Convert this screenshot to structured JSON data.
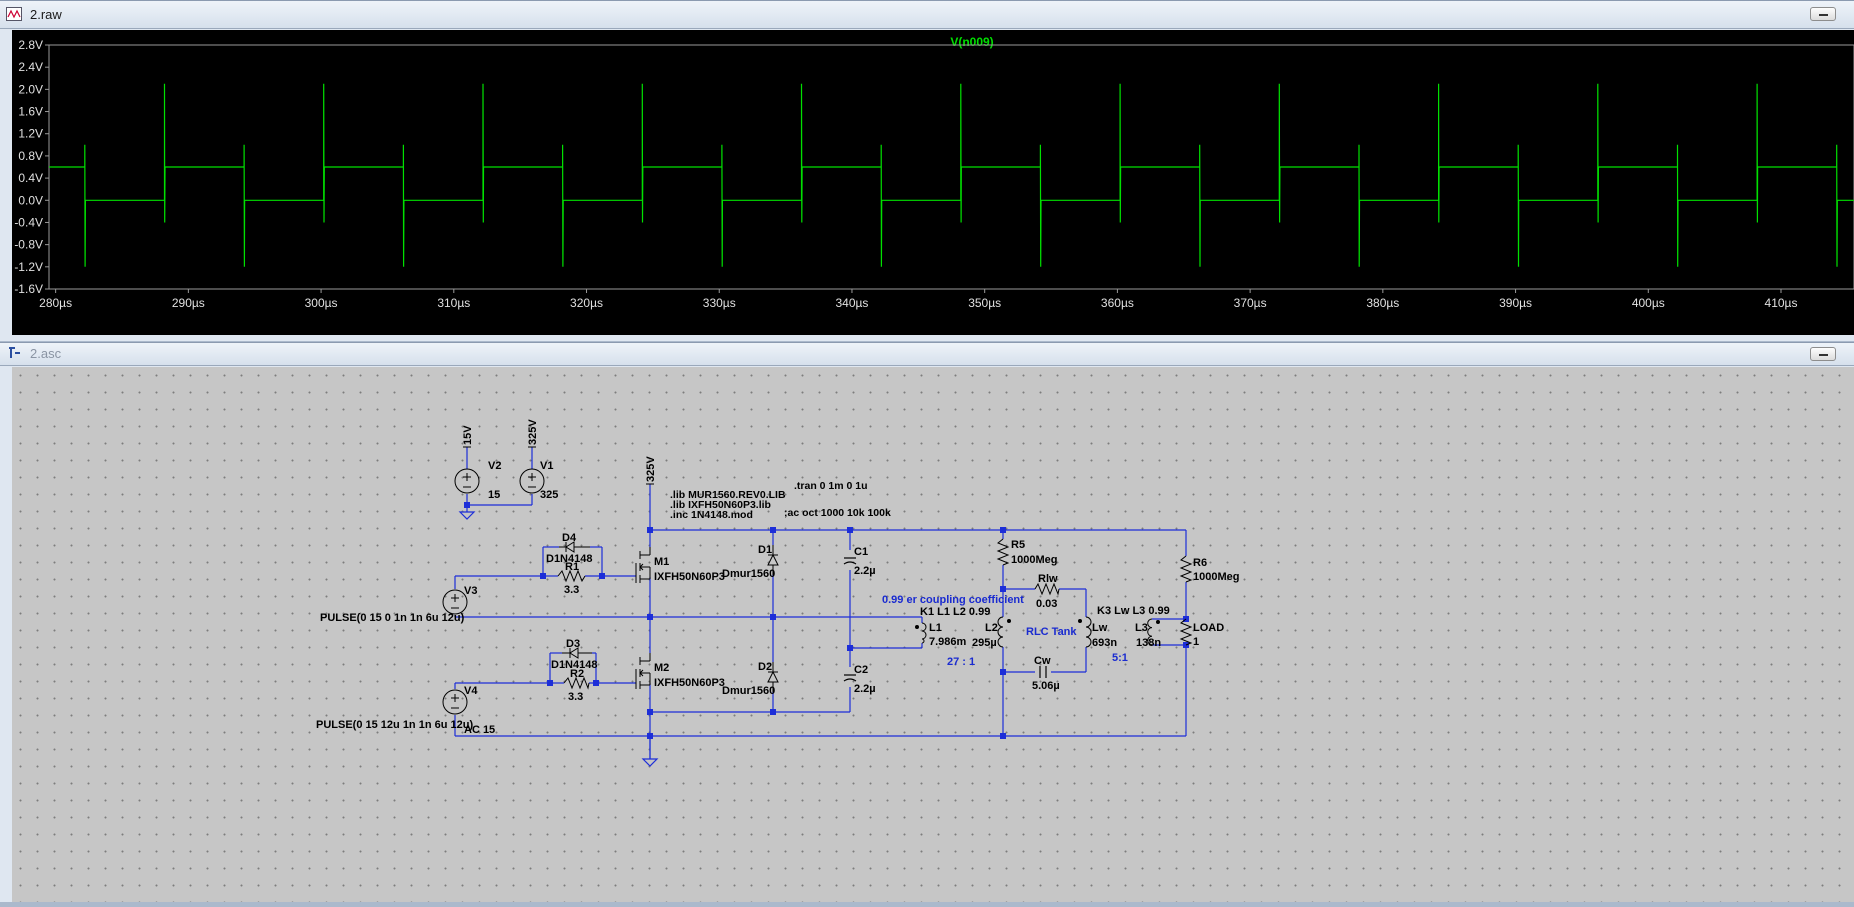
{
  "waveform_window": {
    "title": "2.raw",
    "trace_label": "V(n009)",
    "trace_color": "#00e000",
    "y_ticks": [
      "2.8V",
      "2.4V",
      "2.0V",
      "1.6V",
      "1.2V",
      "0.8V",
      "0.4V",
      "0.0V",
      "-0.4V",
      "-0.8V",
      "-1.2V",
      "-1.6V"
    ],
    "x_ticks": [
      "280µs",
      "290µs",
      "300µs",
      "310µs",
      "320µs",
      "330µs",
      "340µs",
      "350µs",
      "360µs",
      "370µs",
      "380µs",
      "390µs",
      "400µs",
      "410µs"
    ]
  },
  "chart_data": {
    "type": "line",
    "title": "V(n009)",
    "xlabel": "",
    "ylabel": "",
    "xlim": [
      279.5,
      415.5
    ],
    "ylim": [
      -1.6,
      2.8
    ],
    "grid": false,
    "series": [
      {
        "name": "V(n009)",
        "pattern": "square wave, period 12µs, edges every 6µs; high level 0.6V, low level 0.0V; spikes to 2.1V (rising) / -1.2V (falling) with small overshoot to 1.0V / -0.4V",
        "rising_edges_us": [
          288.2,
          300.2,
          312.2,
          324.2,
          336.2,
          348.2,
          360.2,
          372.2,
          384.2,
          396.2,
          408.2
        ],
        "falling_edges_us": [
          282.2,
          294.2,
          306.2,
          318.2,
          330.2,
          342.2,
          354.2,
          366.2,
          378.2,
          390.2,
          402.2,
          414.2
        ],
        "high_level": 0.6,
        "low_level": 0.0,
        "spike_high": 2.1,
        "spike_low": -1.2
      }
    ]
  },
  "schematic_window": {
    "title": "2.asc",
    "sources": {
      "v2": {
        "name": "V2",
        "value": "15",
        "net": "15V"
      },
      "v1": {
        "name": "V1",
        "value": "325",
        "net": "325V"
      },
      "v3": {
        "name": "V3",
        "value": "PULSE(0 15 0 1n 1n 6u 12u)"
      },
      "v4": {
        "name": "V4",
        "value": "PULSE(0 15 12u 1n 1n 6u 12u)",
        "ac": "AC 15"
      },
      "rail": "325V"
    },
    "directives": [
      ".lib MUR1560.REV0.LIB",
      ".lib IXFH50N60P3.lib",
      ".inc 1N4148.mod",
      ".tran 0 1m 0 1u",
      ";ac oct 1000 10k 100k"
    ],
    "components": {
      "d4": {
        "name": "D4",
        "value": "D1N4148"
      },
      "r1": {
        "name": "R1",
        "value": "3.3"
      },
      "d3": {
        "name": "D3",
        "value": "D1N4148"
      },
      "r2": {
        "name": "R2",
        "value": "3.3"
      },
      "m1": {
        "name": "M1",
        "value": "IXFH50N60P3"
      },
      "m2": {
        "name": "M2",
        "value": "IXFH50N60P3"
      },
      "d1": {
        "name": "D1",
        "value": "Dmur1560"
      },
      "d2": {
        "name": "D2",
        "value": "Dmur1560"
      },
      "c1": {
        "name": "C1",
        "value": "2.2µ"
      },
      "c2": {
        "name": "C2",
        "value": "2.2µ"
      },
      "l1": {
        "name": "L1",
        "value": "7.986m"
      },
      "l2": {
        "name": "L2",
        "value": "295µ"
      },
      "r5": {
        "name": "R5",
        "value": "1000Meg"
      },
      "rlw": {
        "name": "Rlw",
        "value": "0.03"
      },
      "lw": {
        "name": "Lw",
        "value": "693n"
      },
      "cw": {
        "name": "Cw",
        "value": "5.06µ"
      },
      "l3": {
        "name": "L3",
        "value": "138n"
      },
      "r6": {
        "name": "R6",
        "value": "1000Meg"
      },
      "load": {
        "name": "LOAD",
        "value": "1"
      }
    },
    "k1": "K1 L1 L2 0.99",
    "k3": "K3 Lw L3 0.99",
    "coupling_comment": "0.99 er coupling coefficient",
    "tank_label": "RLC Tank",
    "ratio1": "27 : 1",
    "ratio2": "5:1"
  }
}
